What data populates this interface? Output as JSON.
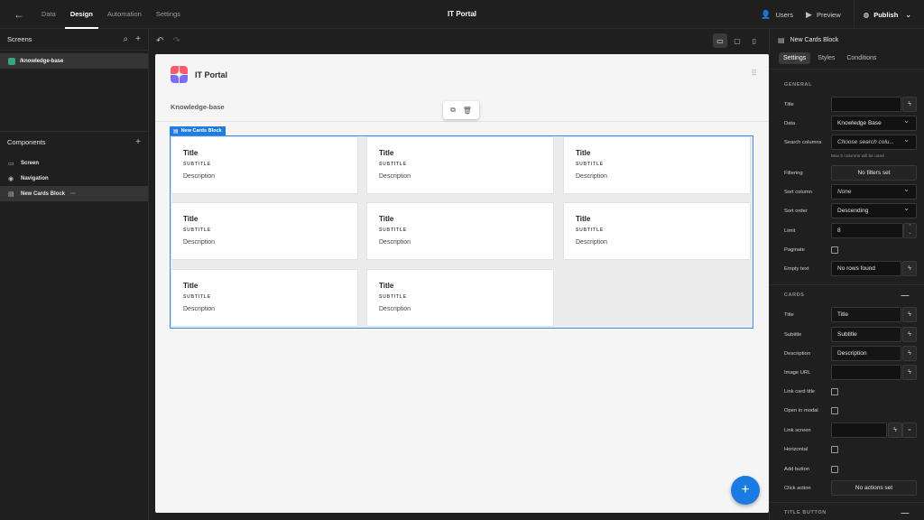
{
  "topbar": {
    "back_icon": "←",
    "tabs": [
      {
        "label": "Data"
      },
      {
        "label": "Design"
      },
      {
        "label": "Automation"
      },
      {
        "label": "Settings"
      }
    ],
    "app_title": "IT Portal",
    "users_label": "Users",
    "preview_label": "Preview",
    "publish_label": "Publish"
  },
  "left": {
    "screens_title": "Screens",
    "screen_item": "/knowledge-base",
    "components_title": "Components",
    "components": [
      {
        "label": "Screen"
      },
      {
        "label": "Navigation"
      },
      {
        "label": "New Cards Block"
      }
    ],
    "more": "···"
  },
  "canvas": {
    "app_name": "IT Portal",
    "page_heading": "Knowledge-base",
    "block_tag": "New Cards Block",
    "cards": [
      {
        "title": "Title",
        "subtitle": "SUBTITLE",
        "description": "Description"
      },
      {
        "title": "Title",
        "subtitle": "SUBTITLE",
        "description": "Description"
      },
      {
        "title": "Title",
        "subtitle": "SUBTITLE",
        "description": "Description"
      },
      {
        "title": "Title",
        "subtitle": "SUBTITLE",
        "description": "Description"
      },
      {
        "title": "Title",
        "subtitle": "SUBTITLE",
        "description": "Description"
      },
      {
        "title": "Title",
        "subtitle": "SUBTITLE",
        "description": "Description"
      },
      {
        "title": "Title",
        "subtitle": "SUBTITLE",
        "description": "Description"
      },
      {
        "title": "Title",
        "subtitle": "SUBTITLE",
        "description": "Description"
      }
    ],
    "fab": "+"
  },
  "right": {
    "block_title": "New Cards Block",
    "tabs": [
      {
        "label": "Settings"
      },
      {
        "label": "Styles"
      },
      {
        "label": "Conditions"
      }
    ],
    "general_heading": "GENERAL",
    "general": {
      "title_label": "Title",
      "title_value": "",
      "data_label": "Data",
      "data_value": "Knowledge Base",
      "search_label": "Search columns",
      "search_placeholder": "Choose search colu...",
      "search_hint": "Max 5 columns will be used",
      "filtering_label": "Filtering",
      "filtering_value": "No filters set",
      "sort_column_label": "Sort column",
      "sort_column_value": "None",
      "sort_order_label": "Sort order",
      "sort_order_value": "Descending",
      "limit_label": "Limit",
      "limit_value": "8",
      "paginate_label": "Paginate",
      "empty_text_label": "Empty text",
      "empty_text_value": "No rows found"
    },
    "cards_heading": "CARDS",
    "cards": {
      "title_label": "Title",
      "title_value": "Title",
      "subtitle_label": "Subtitle",
      "subtitle_value": "Subtitle",
      "description_label": "Description",
      "description_value": "Description",
      "image_label": "Image URL",
      "image_value": "",
      "link_title_label": "Link card title",
      "open_modal_label": "Open in modal",
      "link_screen_label": "Link screen",
      "link_screen_value": "",
      "horizontal_label": "Horizontal",
      "add_button_label": "Add button",
      "click_action_label": "Click action",
      "click_action_value": "No actions set"
    },
    "title_button_heading": "TITLE BUTTON"
  }
}
